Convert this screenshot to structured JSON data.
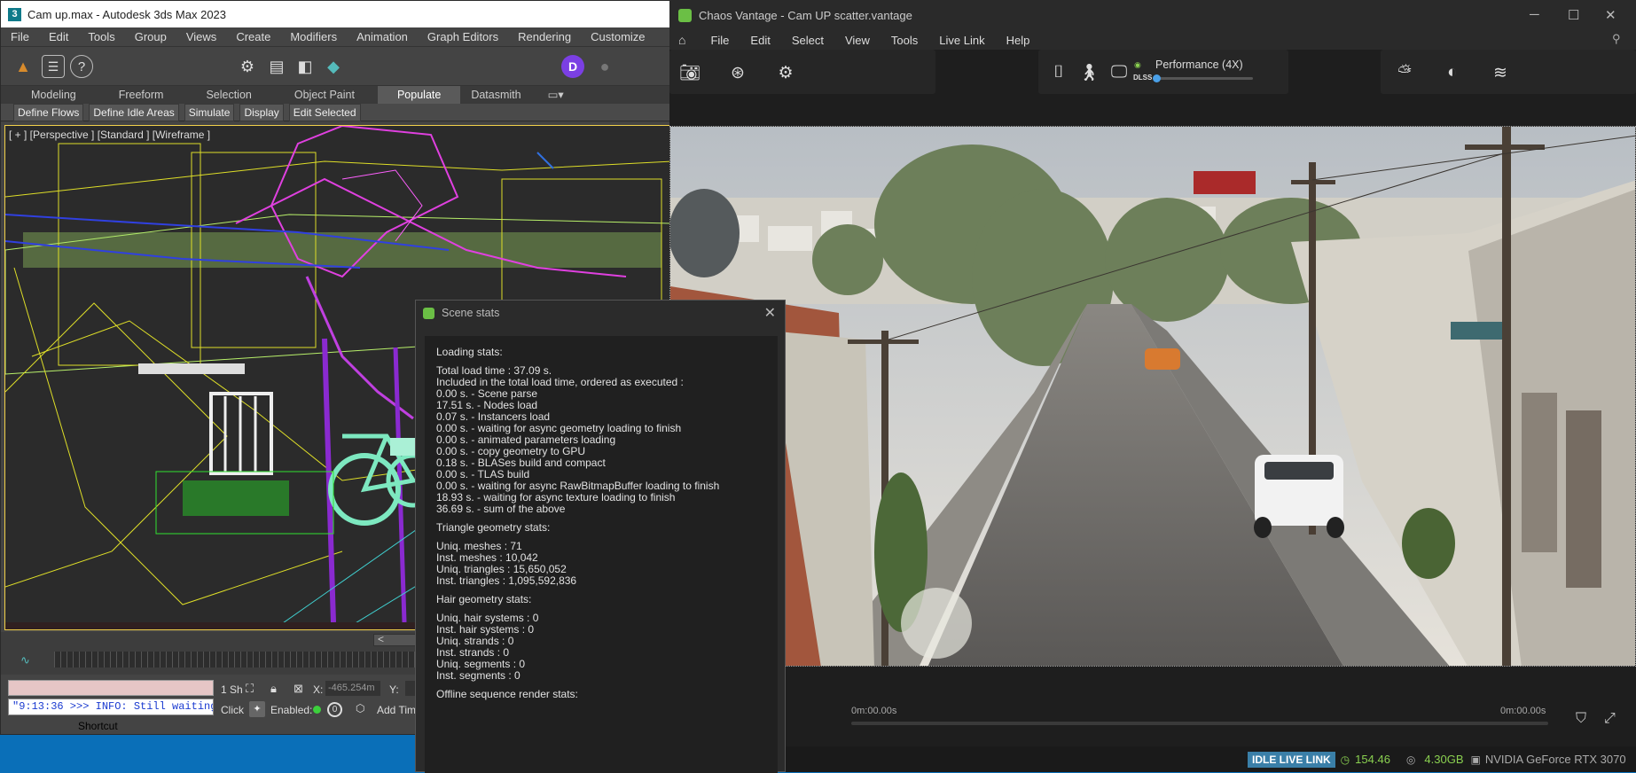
{
  "max": {
    "window_title": "Cam up.max - Autodesk 3ds Max 2023",
    "app_icon_glyph": "3",
    "menu": [
      "File",
      "Edit",
      "Tools",
      "Group",
      "Views",
      "Create",
      "Modifiers",
      "Animation",
      "Graph Editors",
      "Rendering",
      "Customize"
    ],
    "ribbon_tabs": [
      "Modeling",
      "Freeform",
      "Selection",
      "Object Paint",
      "Populate",
      "Datasmith"
    ],
    "ribbon_active": "Populate",
    "ribbon_buttons": [
      "Define Flows",
      "Define Idle Areas",
      "Simulate",
      "Display",
      "Edit Selected"
    ],
    "viewport_label": "[ + ] [Perspective ] [Standard ] [Wireframe ]",
    "maxscript_output": "\"9:13:36 >>> INFO: Still waiting",
    "status": {
      "selection": "1 Sh",
      "click_label": "Click",
      "enabled_label": "Enabled:",
      "enabled_value": "0",
      "x_label": "X:",
      "x_value": "-465.254m",
      "y_label": "Y:",
      "add_time": "Add Time"
    },
    "shortcut_label": "Shortcut",
    "avatar_letter": "D"
  },
  "vantage": {
    "window_title": "Chaos Vantage - Cam UP scatter.vantage",
    "menu": [
      "File",
      "Edit",
      "Select",
      "View",
      "Tools",
      "Live Link",
      "Help"
    ],
    "dlss_label": "DLSS",
    "performance_label": "Performance (4X)",
    "time_start": "0m:00.00s",
    "time_end": "0m:00.00s",
    "status": {
      "live_link": "IDLE LIVE LINK",
      "fps": "154.46",
      "memory": "4.30GB",
      "gpu": "NVIDIA GeForce RTX 3070"
    }
  },
  "stats": {
    "title": "Scene stats",
    "loading_header": "Loading stats:",
    "loading_lines": [
      "Total load time : 37.09 s.",
      "Included in the total load time, ordered as executed :",
      "0.00 s. - Scene parse",
      "17.51 s. - Nodes load",
      "0.07 s. - Instancers load",
      "0.00 s. - waiting for async geometry loading to finish",
      "0.00 s. - animated parameters loading",
      "0.00 s. - copy geometry to GPU",
      "0.18 s. - BLASes build and compact",
      "0.00 s. - TLAS build",
      "0.00 s. - waiting for async RawBitmapBuffer loading to finish",
      "18.93 s. - waiting for async texture loading to finish",
      "36.69 s. - sum of the above"
    ],
    "triangle_header": "Triangle geometry stats:",
    "triangle_lines": [
      "Uniq. meshes : 71",
      "Inst. meshes : 10,042",
      "Uniq. triangles : 15,650,052",
      "Inst. triangles : 1,095,592,836"
    ],
    "hair_header": "Hair geometry stats:",
    "hair_lines": [
      "Uniq. hair systems : 0",
      "Inst. hair systems : 0",
      "Uniq. strands : 0",
      "Inst. strands : 0",
      "Uniq. segments : 0",
      "Inst. segments : 0"
    ],
    "offline_header": "Offline sequence render stats:"
  }
}
